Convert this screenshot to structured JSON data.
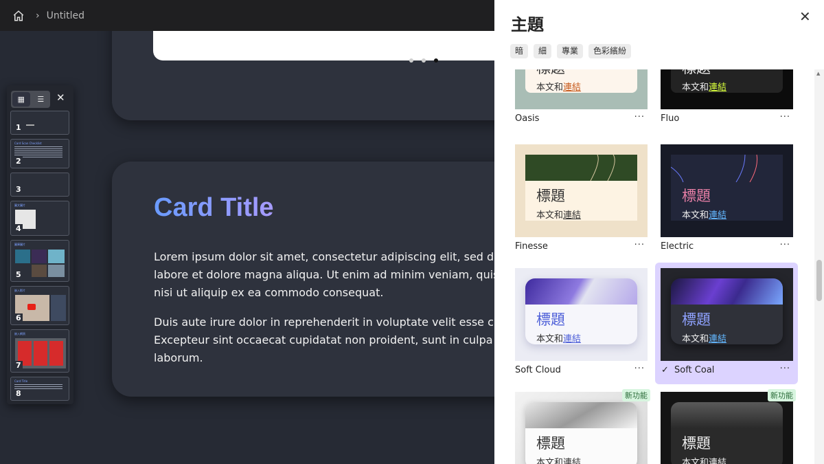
{
  "breadcrumb": {
    "title": "Untitled"
  },
  "slide_card": {
    "title": "Card Title",
    "para1": "Lorem ipsum dolor sit amet, consectetur adipiscing elit, sed do labore et dolore magna aliqua. Ut enim ad minim veniam, quis nisi ut aliquip ex ea commodo consequat.",
    "para1_lines": [
      "Lorem ipsum dolor sit amet, consectetur adipiscing elit, sed do",
      "labore et dolore magna aliqua. Ut enim ad minim veniam, quis",
      "nisi ut aliquip ex ea commodo consequat."
    ],
    "para2_lines": [
      "Duis aute irure dolor in reprehenderit in voluptate velit esse cil",
      "Excepteur sint occaecat cupidatat non proident, sunt in culpa",
      "laborum."
    ]
  },
  "thumbnails": {
    "close": "✕",
    "slides": [
      {
        "num": "1"
      },
      {
        "num": "2",
        "head": "Card Scan Checklist"
      },
      {
        "num": "3"
      },
      {
        "num": "4",
        "head": "圖文圖片"
      },
      {
        "num": "5",
        "head": "圖庫圖片"
      },
      {
        "num": "6",
        "head": "嵌入影片"
      },
      {
        "num": "7",
        "head": "嵌入網頁"
      },
      {
        "num": "8",
        "head": "Card Title"
      }
    ]
  },
  "panel": {
    "title": "主題",
    "close": "✕",
    "filters": [
      "暗",
      "細",
      "專業",
      "色彩繽紛"
    ],
    "heading_sample": "標題",
    "body_sample": "本文和",
    "link_sample": "連結",
    "more": "···",
    "new_badge": "新功能",
    "selected_check": "✓",
    "themes": [
      "Oasis",
      "Fluo",
      "Finesse",
      "Electric",
      "Soft Cloud",
      "Soft Coal"
    ]
  }
}
